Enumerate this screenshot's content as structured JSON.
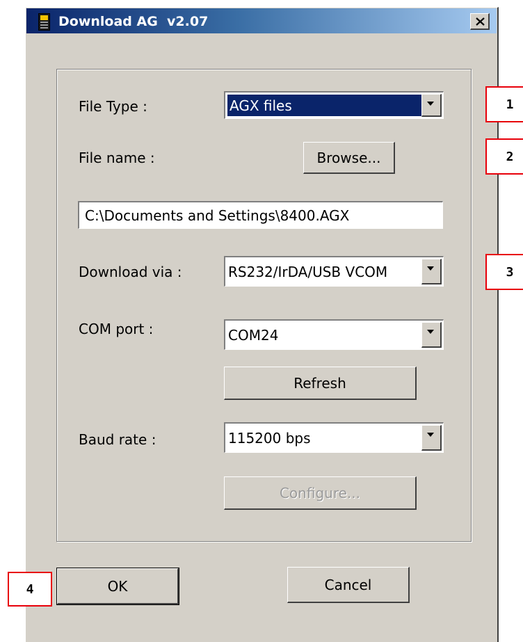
{
  "window": {
    "title": "Download AG  v2.07",
    "icon": "handheld-terminal-icon",
    "close_icon": "close-icon"
  },
  "form": {
    "file_type": {
      "label": "File Type :",
      "value": "AGX files"
    },
    "file_name": {
      "label": "File name :",
      "browse_label": "Browse...",
      "path": "C:\\Documents and Settings\\8400.AGX"
    },
    "download_via": {
      "label": "Download via :",
      "value": "RS232/IrDA/USB VCOM"
    },
    "com_port": {
      "label": "COM port :",
      "value": "COM24",
      "refresh_label": "Refresh"
    },
    "baud_rate": {
      "label": "Baud rate :",
      "value": "115200 bps",
      "configure_label": "Configure..."
    }
  },
  "footer": {
    "ok_label": "OK",
    "cancel_label": "Cancel"
  },
  "callouts": [
    "1",
    "2",
    "3",
    "4"
  ],
  "colors": {
    "callout_border": "#e8000a",
    "selection": "#0a246a",
    "face": "#d4d0c8"
  }
}
